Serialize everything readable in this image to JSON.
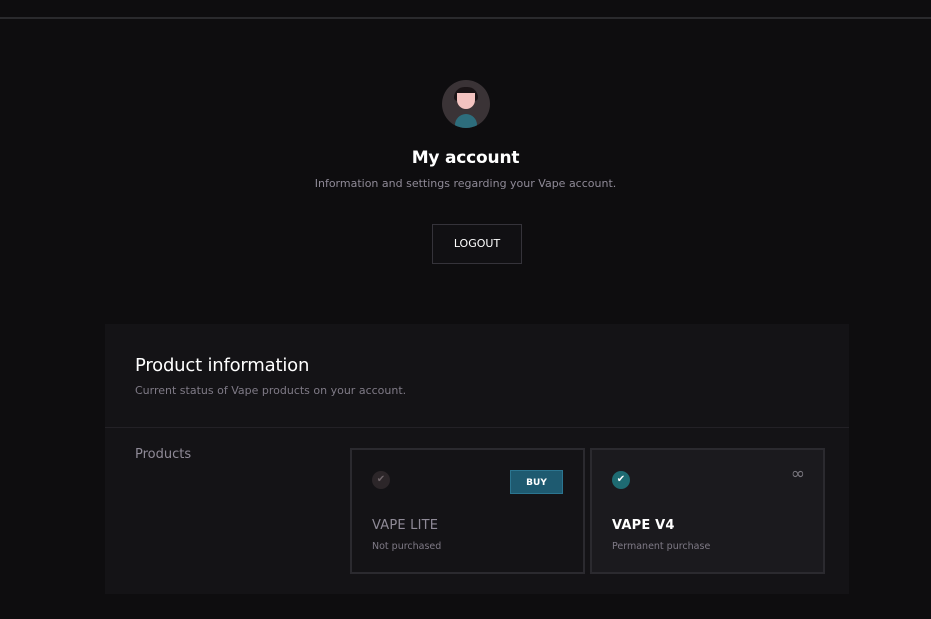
{
  "header": {
    "title": "My account",
    "subtitle": "Information and settings regarding your Vape account.",
    "logout_label": "LOGOUT"
  },
  "product_info": {
    "title": "Product information",
    "subtitle": "Current status of Vape products on your account.",
    "products_label": "Products",
    "products": [
      {
        "name": "VAPE LITE",
        "status": "Not purchased",
        "owned": false,
        "action_label": "BUY",
        "check_icon": "check-icon"
      },
      {
        "name": "VAPE V4",
        "status": "Permanent purchase",
        "owned": true,
        "badge_icon": "infinity-icon",
        "check_icon": "check-icon"
      }
    ]
  },
  "colors": {
    "background": "#0e0d0f",
    "panel": "#141316",
    "accent": "#1e5a70",
    "owned_check": "#1e6b72",
    "avatar_shirt": "#2d6d7c"
  }
}
